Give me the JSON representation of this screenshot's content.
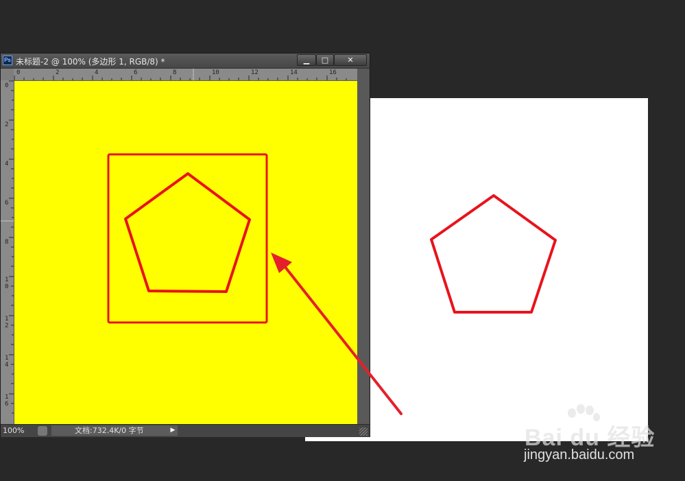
{
  "window": {
    "app_icon": "Ps",
    "title": "未标题-2 @ 100% (多边形 1, RGB/8) *",
    "minimize_label": "▁",
    "maximize_label": "□",
    "close_label": "✕"
  },
  "ruler_h": [
    "0",
    "2",
    "4",
    "6",
    "8",
    "10",
    "12",
    "14",
    "16"
  ],
  "ruler_v": [
    "0",
    "2",
    "4",
    "6",
    "8",
    "1 0",
    "1 2",
    "1 4",
    "1 6"
  ],
  "status": {
    "zoom": "100%",
    "doc_info": "文档:732.4K/0 字节",
    "menu_arrow": "▶"
  },
  "colors": {
    "canvas": "#ffff00",
    "shape_stroke": "#e8131c",
    "white_doc": "#ffffff",
    "app_bg": "#282828"
  },
  "watermark": {
    "logo_text": "Bai du 经验",
    "url": "jingyan.baidu.com"
  }
}
